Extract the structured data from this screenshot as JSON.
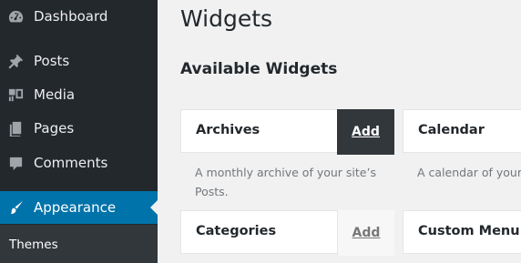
{
  "sidebar": {
    "items": [
      {
        "label": "Dashboard",
        "icon": "dashboard-icon"
      },
      {
        "label": "Posts",
        "icon": "pin-icon"
      },
      {
        "label": "Media",
        "icon": "media-icon"
      },
      {
        "label": "Pages",
        "icon": "pages-icon"
      },
      {
        "label": "Comments",
        "icon": "comment-icon"
      },
      {
        "label": "Appearance",
        "icon": "brush-icon",
        "active": true
      }
    ],
    "submenu": [
      {
        "label": "Themes"
      }
    ],
    "colors": {
      "background": "#23282d",
      "active": "#0073aa",
      "submenu": "#32373c"
    }
  },
  "main": {
    "title": "Widgets",
    "section_title": "Available Widgets",
    "widgets": [
      {
        "name": "Archives",
        "add_label": "Add",
        "description": "A monthly archive of your site’s Posts.",
        "description_line1": "A monthly archive of your site’s",
        "description_line2": "Posts."
      },
      {
        "name": "Calendar",
        "description": "A calendar of your"
      },
      {
        "name": "Categories",
        "add_label": "Add"
      },
      {
        "name": "Custom Menu"
      }
    ]
  }
}
